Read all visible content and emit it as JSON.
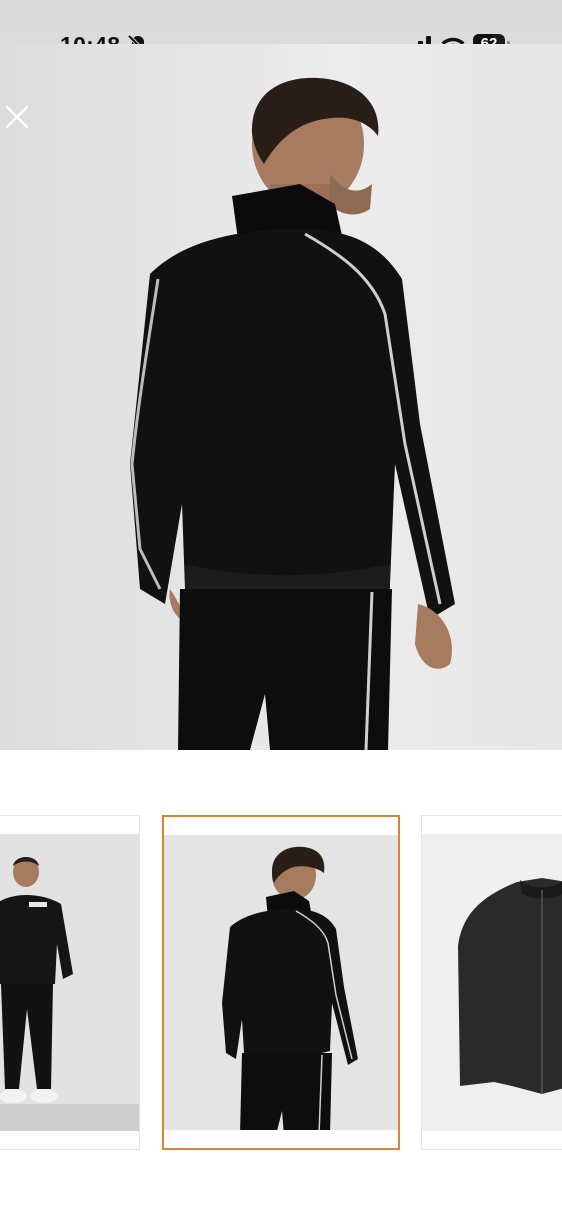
{
  "status_bar": {
    "time": "10:48",
    "battery_level": "62",
    "icons": [
      "bell-off-icon",
      "cellular-signal-icon",
      "wifi-icon",
      "battery-icon"
    ]
  },
  "viewer": {
    "close_icon": "close-icon",
    "main_image": "model-back-view-black-track-jacket",
    "thumbnails": [
      {
        "image": "model-front-view-full-tracksuit",
        "selected": false
      },
      {
        "image": "model-back-view-black-track-jacket",
        "selected": true
      },
      {
        "image": "black-zip-jacket-product-shot",
        "selected": false
      }
    ],
    "accent_color": "#d4863a"
  }
}
